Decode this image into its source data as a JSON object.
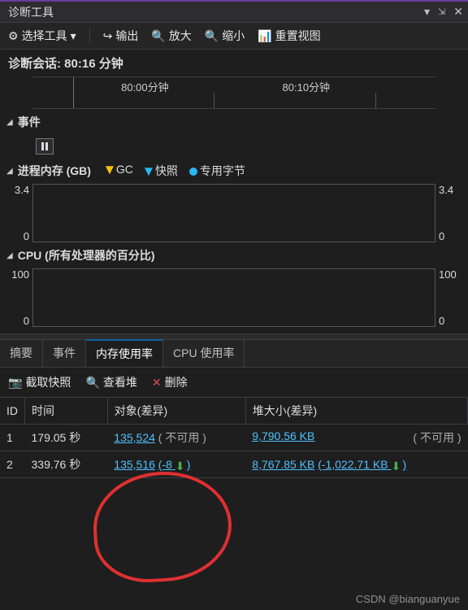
{
  "title": "诊断工具",
  "toolbar": {
    "select_tool": "选择工具",
    "output": "输出",
    "zoom_in": "放大",
    "zoom_out": "缩小",
    "reset_view": "重置视图"
  },
  "session": {
    "label": "诊断会话:",
    "value": "80:16 分钟"
  },
  "ruler": {
    "t1": "80:00分钟",
    "t2": "80:10分钟"
  },
  "sections": {
    "events": "事件",
    "memory": "进程内存 (GB)",
    "cpu": "CPU (所有处理器的百分比)"
  },
  "legend": {
    "gc": "GC",
    "snapshot": "快照",
    "private_bytes": "专用字节"
  },
  "memory_axis": {
    "max": "3.4",
    "min": "0"
  },
  "cpu_axis": {
    "max": "100",
    "min": "0"
  },
  "tabs": {
    "summary": "摘要",
    "events": "事件",
    "memory_usage": "内存使用率",
    "cpu_usage": "CPU 使用率"
  },
  "snap_toolbar": {
    "take_snapshot": "截取快照",
    "view_heap": "查看堆",
    "delete": "删除"
  },
  "grid_headers": {
    "id": "ID",
    "time": "时间",
    "objects_diff": "对象(差异)",
    "heap_diff": "堆大小(差异)"
  },
  "rows": [
    {
      "id": "1",
      "time": "179.05 秒",
      "objects": "135,524",
      "objects_diff": "( 不可用 )",
      "heap": "9,790.56 KB",
      "heap_diff": "( 不可用 )"
    },
    {
      "id": "2",
      "time": "339.76 秒",
      "objects": "135,516",
      "objects_diff": "(-8",
      "heap": "8,767.85 KB",
      "heap_diff": "(-1,022.71 KB"
    }
  ],
  "watermark": "CSDN @bianguanyue",
  "chart_data": [
    {
      "type": "line",
      "title": "进程内存 (GB)",
      "ylim": [
        0,
        3.4
      ],
      "x": [],
      "series": []
    },
    {
      "type": "line",
      "title": "CPU (所有处理器的百分比)",
      "ylim": [
        0,
        100
      ],
      "x": [],
      "series": []
    }
  ]
}
